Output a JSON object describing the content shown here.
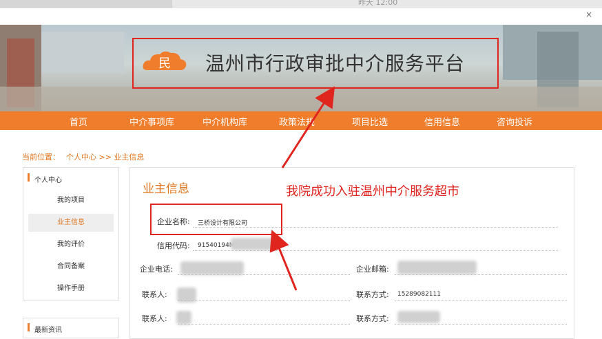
{
  "window": {
    "clock": "昨天 12:00",
    "close_glyph": "×"
  },
  "site": {
    "title": "温州市行政审批中介服务平台",
    "logo_char": "民"
  },
  "nav": [
    "首页",
    "中介事项库",
    "中介机构库",
    "政策法规",
    "项目比选",
    "信用信息",
    "咨询投诉"
  ],
  "breadcrumb": {
    "label": "当前位置：",
    "path": "个人中心 >> 业主信息"
  },
  "sidebar": {
    "heading": "个人中心",
    "items": [
      "我的项目",
      "业主信息",
      "我的评价",
      "合同备案",
      "操作手册"
    ],
    "active_index": 1,
    "news_heading": "最新资讯"
  },
  "main": {
    "title": "业主信息",
    "annotation": "我院成功入驻温州中介服务超市",
    "fields": {
      "company_name_label": "企业名称:",
      "company_name_value": "三桥设计有限公司",
      "credit_code_label": "信用代码:",
      "credit_code_value": "91540194M",
      "phone_label": "企业电话:",
      "email_label": "企业邮箱:",
      "contact1_label": "联系人:",
      "contact1_method_label": "联系方式:",
      "contact1_method_value": "15289082111",
      "contact2_label": "联系人:",
      "contact2_method_label": "联系方式:"
    }
  },
  "colors": {
    "accent": "#f07d2c",
    "annotation": "#e0251f"
  }
}
